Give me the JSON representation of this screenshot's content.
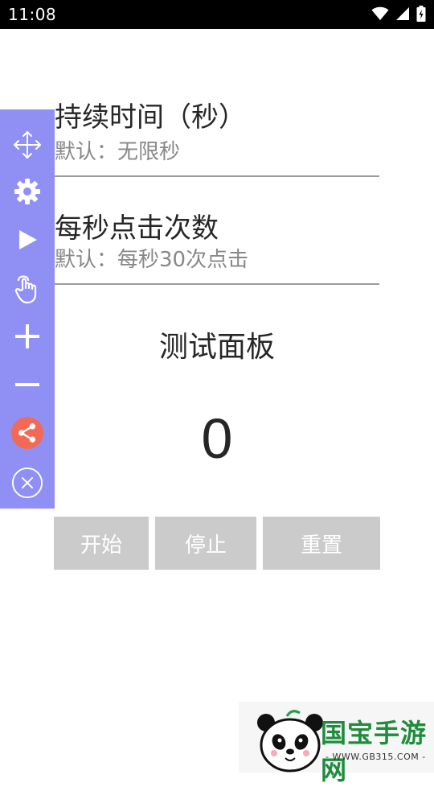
{
  "status_bar": {
    "time": "11:08"
  },
  "duration_field": {
    "title": "持续时间（秒）",
    "hint": "默认：无限秒"
  },
  "clicks_field": {
    "title": "每秒点击次数",
    "hint": "默认：每秒30次点击"
  },
  "test_panel": {
    "title": "测试面板",
    "counter": "0"
  },
  "buttons": {
    "start": "开始",
    "stop": "停止",
    "reset": "重置"
  },
  "floating_toolbar": {
    "color": "#8f8ff4",
    "icons": [
      "move-icon",
      "gear-icon",
      "play-icon",
      "tap-gesture-icon",
      "plus-icon",
      "minus-icon",
      "share-icon",
      "close-icon"
    ]
  },
  "watermark": {
    "brand": "国宝手游网",
    "url": "- WWW.GB315.COM -"
  }
}
